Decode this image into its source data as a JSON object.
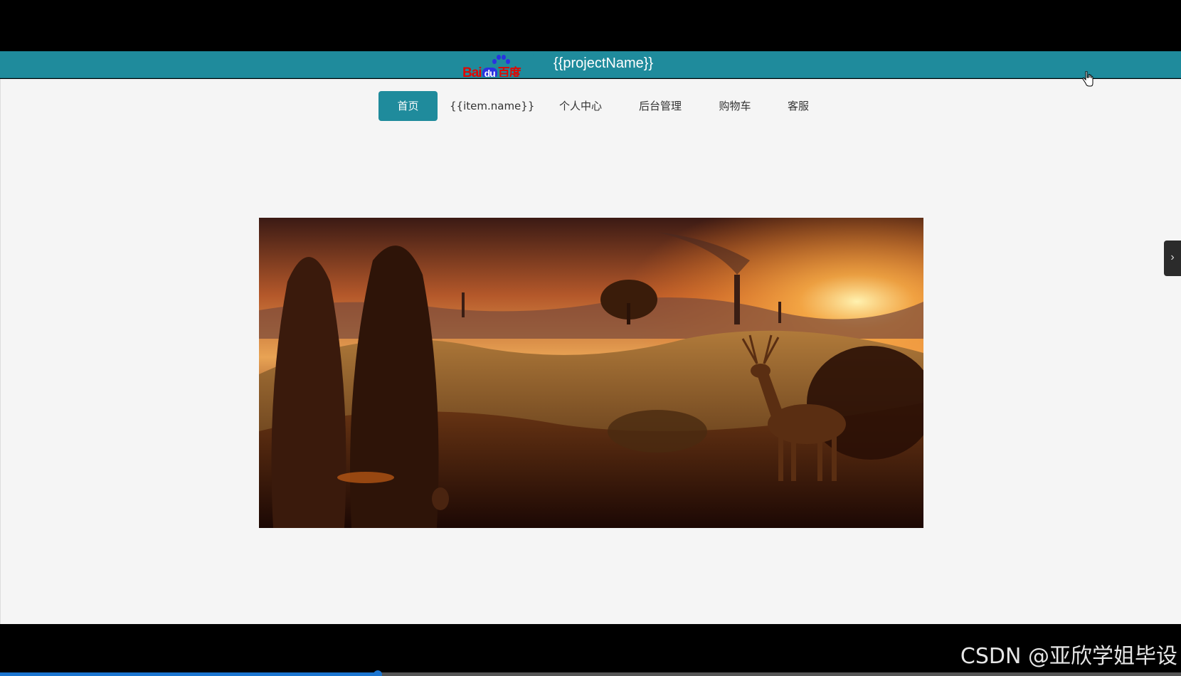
{
  "header": {
    "logo": {
      "bai": "Bai",
      "du": "du",
      "cn": "百度"
    },
    "project_name": "{{projectName}}",
    "background_color": "#1f8b9c"
  },
  "nav": {
    "items": [
      {
        "label": "首页",
        "active": true
      },
      {
        "label": "{{item.name}}",
        "active": false
      },
      {
        "label": "个人中心",
        "active": false
      },
      {
        "label": "后台管理",
        "active": false
      },
      {
        "label": "购物车",
        "active": false
      },
      {
        "label": "客服",
        "active": false
      }
    ]
  },
  "banner": {
    "icon": "landscape-deer-sunset-image"
  },
  "carousel": {
    "next_arrow": "›"
  },
  "watermark": "CSDN @亚欣学姐毕设",
  "video_progress": {
    "fraction": 0.32,
    "color": "#1b75d0"
  }
}
